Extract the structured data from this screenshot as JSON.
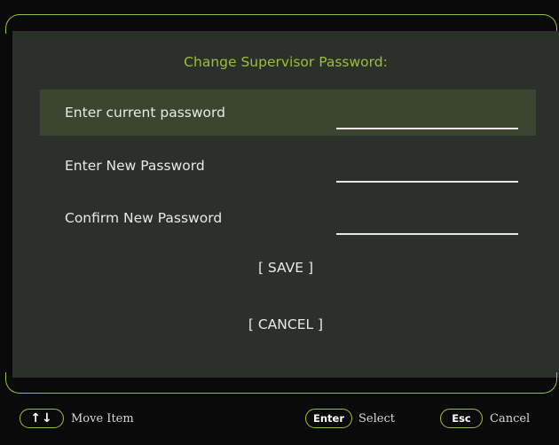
{
  "dialog": {
    "title": "Change Supervisor Password:",
    "fields": [
      {
        "label": "Enter current password",
        "value": ""
      },
      {
        "label": "Enter New Password",
        "value": ""
      },
      {
        "label": "Confirm New Password",
        "value": ""
      }
    ],
    "save_label": "[ SAVE ]",
    "cancel_label": "[ CANCEL ]"
  },
  "footer": {
    "move_key": "↑↓",
    "move_label": "Move Item",
    "enter_key": "Enter",
    "enter_label": "Select",
    "esc_key": "Esc",
    "esc_label": "Cancel"
  },
  "colors": {
    "accent": "#9bbf3a",
    "panel_bg": "#2c302b",
    "selected_row_bg": "#3b4530",
    "page_bg": "#0a0a0a",
    "text": "#e8e8e8"
  }
}
